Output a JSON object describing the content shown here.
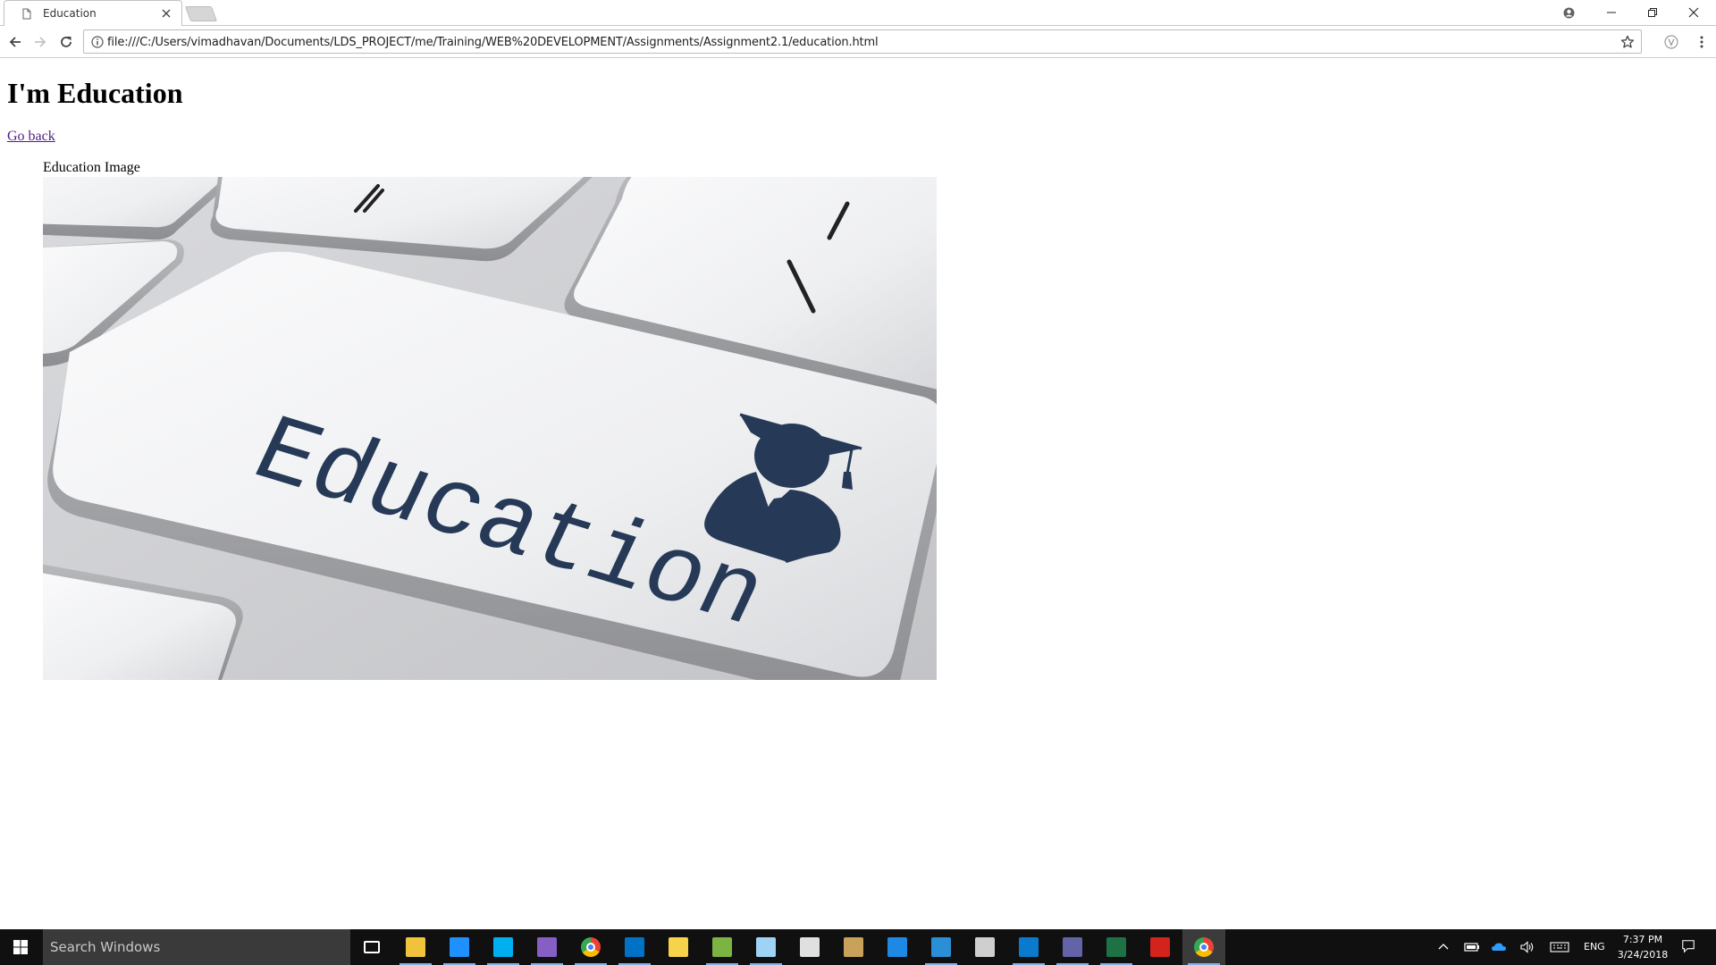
{
  "browser": {
    "tab_title": "Education",
    "url": "file:///C:/Users/vimadhavan/Documents/LDS_PROJECT/me/Training/WEB%20DEVELOPMENT/Assignments/Assignment2.1/education.html"
  },
  "page": {
    "heading": "I'm Education",
    "back_link": "Go back",
    "image_caption": "Education Image",
    "image_word": "Education"
  },
  "taskbar": {
    "search_placeholder": "Search Windows",
    "language": "ENG",
    "time": "7:37 PM",
    "date": "3/24/2018",
    "apps": [
      {
        "icon": "task-view-icon",
        "color": "#ffffff"
      },
      {
        "icon": "file-explorer-icon",
        "color": "#f0c33c"
      },
      {
        "icon": "internet-explorer-icon",
        "color": "#1e90ff"
      },
      {
        "icon": "skype-icon",
        "color": "#00aff0"
      },
      {
        "icon": "visual-studio-icon",
        "color": "#865fc5"
      },
      {
        "icon": "chrome-icon",
        "color": "#ea4335"
      },
      {
        "icon": "outlook-icon",
        "color": "#0072c6"
      },
      {
        "icon": "sticky-notes-icon",
        "color": "#f7d24b"
      },
      {
        "icon": "android-studio-icon",
        "color": "#7cb342"
      },
      {
        "icon": "notepad-icon",
        "color": "#9fd3f5"
      },
      {
        "icon": "sublime-icon",
        "color": "#e0e0e0"
      },
      {
        "icon": "tools-icon",
        "color": "#c8a25a"
      },
      {
        "icon": "edge-icon",
        "color": "#1e88e5"
      },
      {
        "icon": "brackets-icon",
        "color": "#2a8fd4"
      },
      {
        "icon": "vpn-icon",
        "color": "#cfcfcf"
      },
      {
        "icon": "vscode-icon",
        "color": "#0a7acc"
      },
      {
        "icon": "teams-icon",
        "color": "#6264a7"
      },
      {
        "icon": "excel-icon",
        "color": "#1d7145"
      },
      {
        "icon": "acrobat-icon",
        "color": "#d4221d"
      },
      {
        "icon": "chrome-active-icon",
        "color": "#fbbc04"
      }
    ]
  }
}
